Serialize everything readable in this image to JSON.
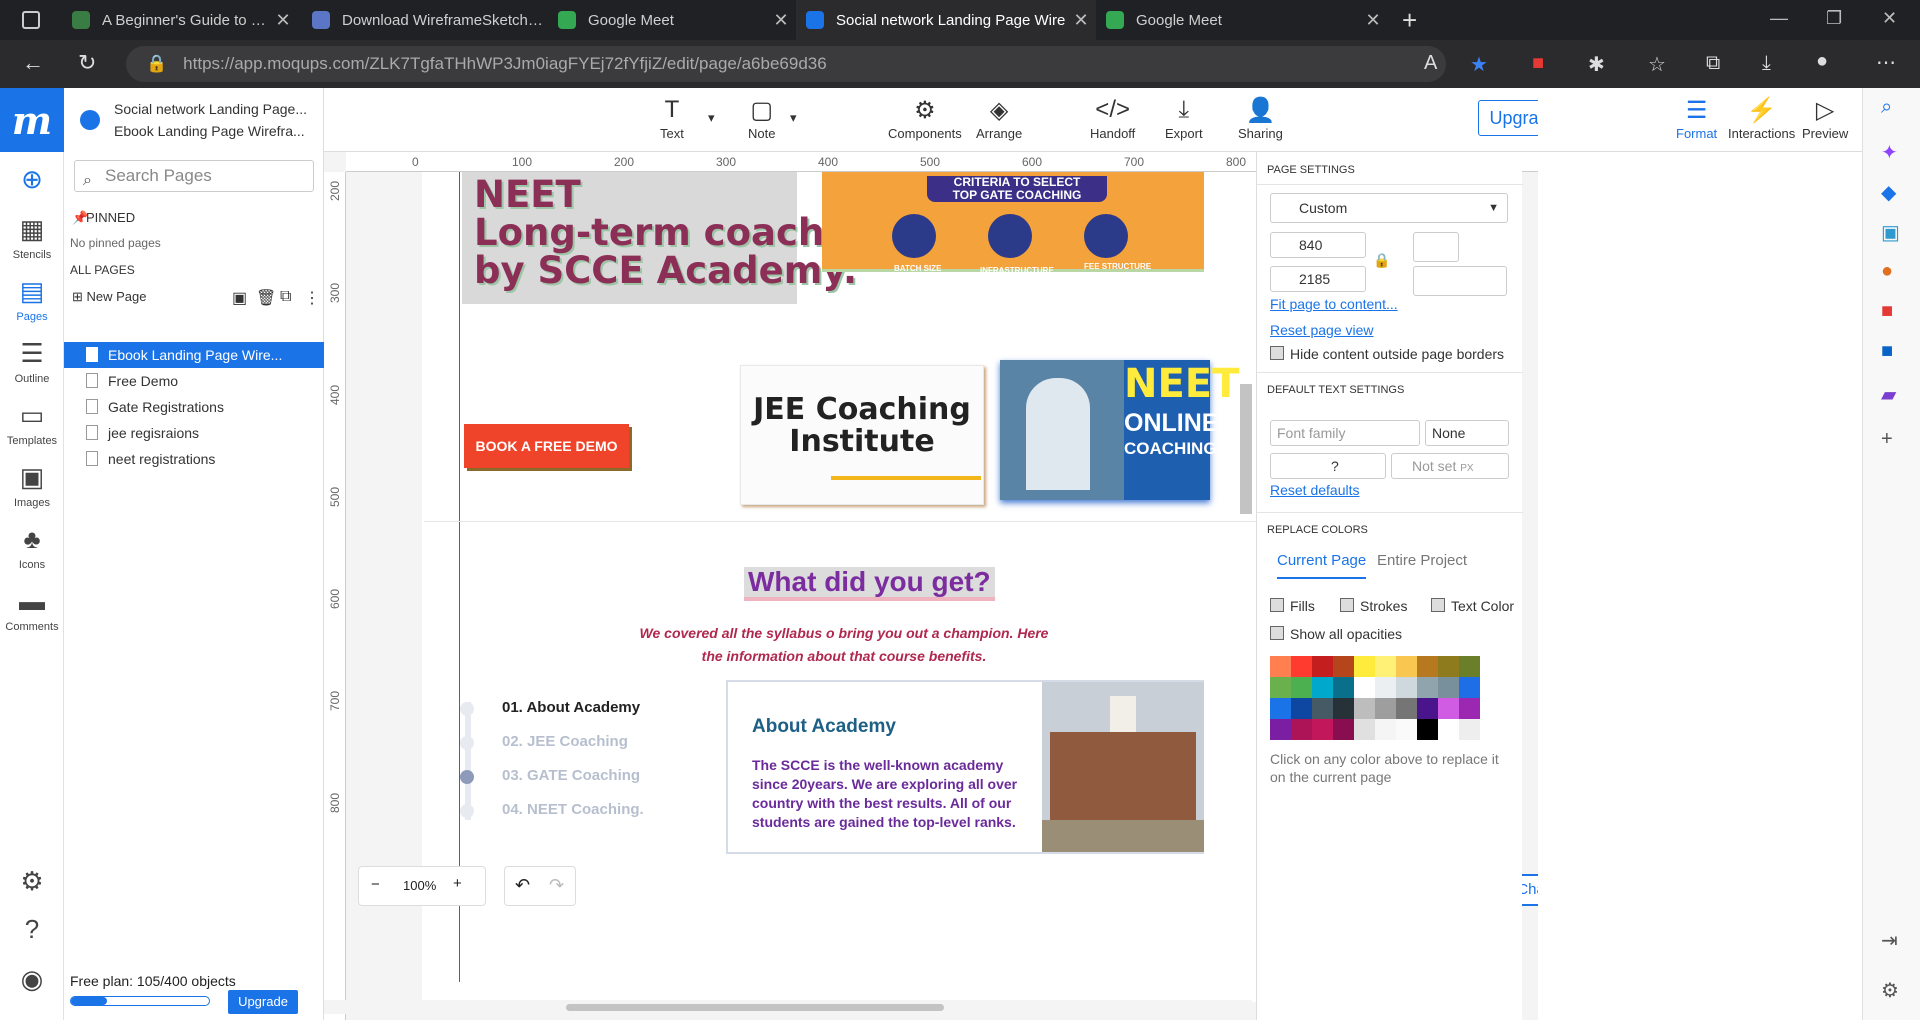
{
  "browser": {
    "tabs": [
      {
        "label": "A Beginner's Guide to Wireframing",
        "color": "#3a7d44"
      },
      {
        "label": "Download WireframeSketcher - Un",
        "color": "#5b76c6"
      },
      {
        "label": "Google Meet",
        "color": "#34a853"
      },
      {
        "label": "Social network Landing Page Wire",
        "color": "#1a74e8"
      },
      {
        "label": "Google Meet",
        "color": "#34a853"
      }
    ],
    "url": "https://app.moqups.com/ZLK7TgfaTHhWP3Jm0iagFYEj72fYfjiZ/edit/page/a6be69d36"
  },
  "app": {
    "project_title": "Social network Landing Page...",
    "page_title": "Ebook Landing Page Wirefra...",
    "rail": [
      "Stencils",
      "Pages",
      "Outline",
      "Templates",
      "Images",
      "Icons",
      "Comments"
    ],
    "search_placeholder": "Search Pages",
    "pinned_label": "PINNED",
    "no_pinned": "No pinned pages",
    "all_pages": "ALL PAGES",
    "new_page": "New Page",
    "pages": [
      "Ebook Landing Page Wire...",
      "Free Demo",
      "Gate Registrations",
      "jee regisraions",
      "neet registrations"
    ],
    "plan_text": "Free plan: 105/400 objects",
    "plan_fraction": 0.26,
    "upgrade_small": "Upgrade"
  },
  "toolbar": {
    "tools": [
      "Text",
      "Note",
      "Components",
      "Arrange",
      "Handoff",
      "Export",
      "Sharing"
    ],
    "upgrade_now": "Upgrade now",
    "right": [
      "Format",
      "Interactions",
      "Preview"
    ]
  },
  "canvas": {
    "ruler_h": [
      "0",
      "100",
      "200",
      "300",
      "400",
      "500",
      "600",
      "700",
      "800"
    ],
    "ruler_v": [
      "200",
      "300",
      "400",
      "500",
      "600",
      "700",
      "800"
    ],
    "neet_title": "NEET\nLong-term coaching\nby SCCE Academy.",
    "banner_head": "CRITERIA TO SELECT\nTOP GATE COACHING",
    "banner_labels": [
      "BATCH SIZE",
      "INFRASTRUCTURE",
      "FEE STRUCTURE"
    ],
    "book_demo": "BOOK A FREE DEMO",
    "jee_text": "JEE Coaching Institute",
    "neet_img": {
      "l1": "NEET",
      "l2": "ONLINE",
      "l3": "COACHING"
    },
    "what_title": "What did you get?",
    "cover_text": "We covered all the syllabus o bring you out a champion. Here the information about that course benefits.",
    "timeline": [
      "01. About Academy",
      "02. JEE Coaching",
      "03. GATE Coaching",
      "04. NEET Coaching."
    ],
    "card_title": "About Academy",
    "card_text": " The SCCE is the well-known academy since 20years. We are exploring all over country with the best results. All of our students are gained the top-level ranks.",
    "zoom": "100%",
    "chat": "Chat"
  },
  "props": {
    "page_settings": "PAGE SETTINGS",
    "preset": "Custom",
    "width": "840",
    "height": "2185",
    "fit": "Fit page to content...",
    "reset": "Reset page view",
    "hide": "Hide content outside page borders",
    "default_text": "DEFAULT TEXT SETTINGS",
    "font_family": "Font family",
    "none": "None",
    "size_q": "?",
    "not_set": "Not set",
    "px": "PX",
    "reset_defaults": "Reset defaults",
    "replace_colors": "REPLACE COLORS",
    "tab_current": "Current Page",
    "tab_entire": "Entire Project",
    "fills": "Fills",
    "strokes": "Strokes",
    "text_color": "Text Color",
    "show_all": "Show all opacities",
    "hint": "Click on any color above to replace it on the current page",
    "swatches": [
      "#ff7f50",
      "#ff3b30",
      "#c41e1e",
      "#b5451b",
      "#ffeb3b",
      "#fff176",
      "#f9c74f",
      "#b7791f",
      "#8d7b1d",
      "#6b7f2a",
      "#6ab04c",
      "#4caf50",
      "#00a8cc",
      "#0a6f8a",
      "#ffffff",
      "#eceff1",
      "#cfd8dc",
      "#90a4ae",
      "#78909c",
      "#1e6ee8",
      "#1a74e8",
      "#0d47a1",
      "#455a64",
      "#263238",
      "#bdbdbd",
      "#9e9e9e",
      "#757575",
      "#4a148c",
      "#d05ce3",
      "#9c27b0",
      "#7b1fa2",
      "#ad1457",
      "#c2185b",
      "#880e4f",
      "#e0e0e0",
      "#f5f5f5",
      "#fafafa",
      "#000000",
      "#ffffff",
      "#eeeeee"
    ]
  }
}
